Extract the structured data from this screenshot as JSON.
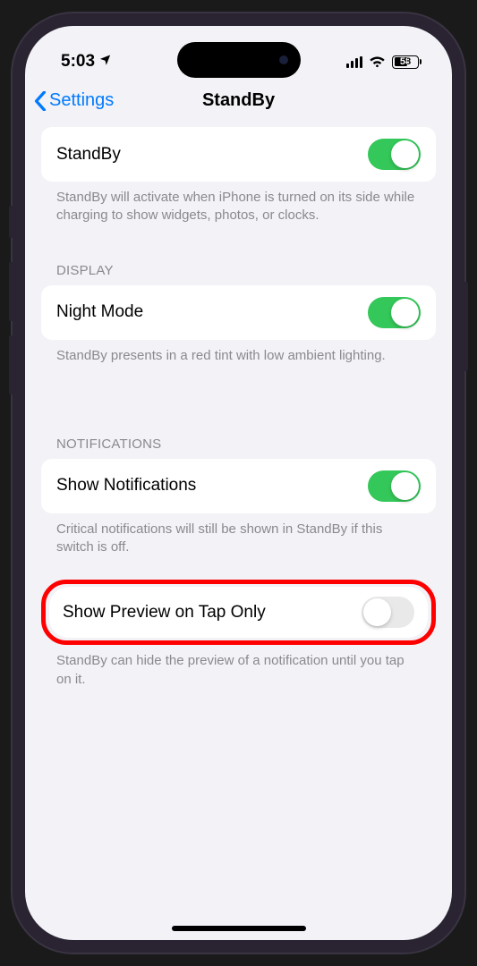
{
  "status_bar": {
    "time": "5:03",
    "battery_percent": "58"
  },
  "nav": {
    "back_label": "Settings",
    "title": "StandBy"
  },
  "standby": {
    "label": "StandBy",
    "enabled": true,
    "footer": "StandBy will activate when iPhone is turned on its side while charging to show widgets, photos, or clocks."
  },
  "display_section": {
    "header": "DISPLAY",
    "night_mode": {
      "label": "Night Mode",
      "enabled": true,
      "footer": "StandBy presents in a red tint with low ambient lighting."
    }
  },
  "notifications_section": {
    "header": "NOTIFICATIONS",
    "show_notifications": {
      "label": "Show Notifications",
      "enabled": true,
      "footer": "Critical notifications will still be shown in StandBy if this switch is off."
    },
    "show_preview": {
      "label": "Show Preview on Tap Only",
      "enabled": false,
      "footer": "StandBy can hide the preview of a notification until you tap on it."
    }
  }
}
